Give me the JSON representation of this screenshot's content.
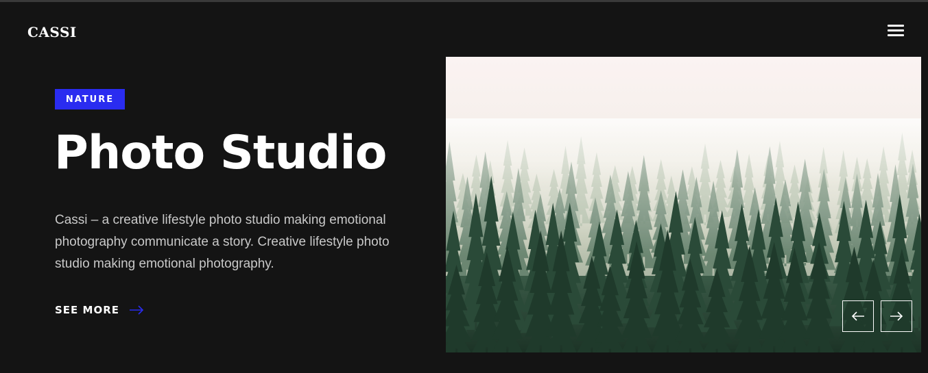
{
  "brand": {
    "logo": "CASSI"
  },
  "hero": {
    "tag": "NATURE",
    "title": "Photo Studio",
    "description": "Cassi – a creative lifestyle photo studio making emotional photography communicate a story. Creative lifestyle photo studio making emotional photography.",
    "cta_label": "SEE MORE"
  },
  "icons": {
    "menu": "hamburger-menu-icon",
    "cta": "arrow-right-icon",
    "prev": "arrow-left-icon",
    "next": "arrow-right-icon"
  },
  "colors": {
    "background": "#141414",
    "accent": "#2a2cf0",
    "text": "#ffffff",
    "muted_text": "#c9c9c9"
  }
}
